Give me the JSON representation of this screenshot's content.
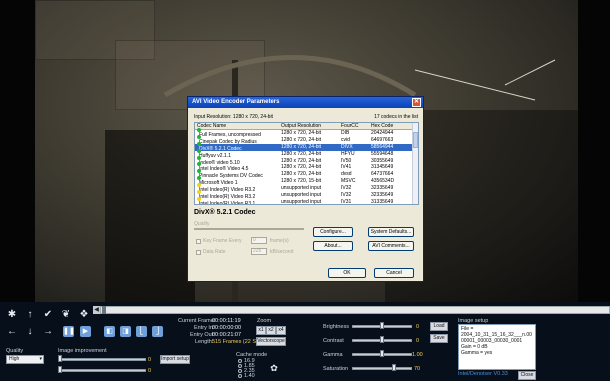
{
  "dialog": {
    "title": "AVI Video Encoder Parameters",
    "input_resolution": "Input Resolution:  1280 x 720, 24-bit",
    "codec_count": "17 codecs in the list",
    "columns": [
      "Codec Name",
      "Output Resolution",
      "FourCC",
      "Hex Code"
    ],
    "codecs": [
      {
        "name": "Full Frames, uncompressed",
        "res": "1280 x 720, 24-bit",
        "fourcc": "DIB",
        "hex": "20424944",
        "status": "ok"
      },
      {
        "name": "Cinepak Codec by Radius",
        "res": "1280 x 720, 24-bit",
        "fourcc": "cvid",
        "hex": "64697663",
        "status": "ok"
      },
      {
        "name": "DivX® 5.2.1 Codec",
        "res": "1280 x 720, 24-bit",
        "fourcc": "DIVX",
        "hex": "58564944",
        "status": "ok",
        "selected": true
      },
      {
        "name": "Huffyuv v2.1.1",
        "res": "1280 x 720, 24-bit",
        "fourcc": "HFYU",
        "hex": "55594648",
        "status": "ok"
      },
      {
        "name": "Indeo® video 5.10",
        "res": "1280 x 720, 24-bit",
        "fourcc": "IV50",
        "hex": "30355649",
        "status": "ok"
      },
      {
        "name": "Intel Indeo® Video 4.5",
        "res": "1280 x 720, 24-bit",
        "fourcc": "IV41",
        "hex": "31345649",
        "status": "ok"
      },
      {
        "name": "Pinnacle Systems DV Codec",
        "res": "1280 x 720, 24-bit",
        "fourcc": "dvsd",
        "hex": "64737664",
        "status": "ok"
      },
      {
        "name": "Microsoft Video 1",
        "res": "1280 x 720, 15-bit",
        "fourcc": "MSVC",
        "hex": "4356534D",
        "status": "ok"
      },
      {
        "name": "Intel Indeo(R) Video R3.2",
        "res": "unsupported input",
        "fourcc": "IV32",
        "hex": "32335649",
        "status": "warn"
      },
      {
        "name": "Intel Indeo(R) Video R3.2",
        "res": "unsupported input",
        "fourcc": "IV32",
        "hex": "32335649",
        "status": "warn"
      },
      {
        "name": "Intel Indeo(R) Video R3.1",
        "res": "unsupported input",
        "fourcc": "IV31",
        "hex": "31335649",
        "status": "warn"
      }
    ],
    "selected_codec": "DivX® 5.2.1 Codec",
    "quality_label": "Quality",
    "key_frame_label": "Key Frame Every",
    "key_frame_value": "0",
    "key_frame_unit": "frame(s)",
    "data_rate_label": "Data Rate",
    "data_rate_value": "225",
    "data_rate_unit": "kB/second",
    "buttons": {
      "configure": "Configure...",
      "system_defaults": "System Defaults...",
      "about": "About...",
      "avi_comments": "AVI Comments...",
      "ok": "OK",
      "cancel": "Cancel"
    },
    "close_glyph": "✕"
  },
  "controls": {
    "current_frame_label": "Current Frame:",
    "current_frame": "00:00:11:19",
    "entry_in_label": "Entry In:",
    "entry_in": "00:00:00:00",
    "entry_out_label": "Entry Out:",
    "entry_out": "00:00:21:07",
    "length_label": "Length:",
    "length": "515 Frames (22 Sec)",
    "zoom_label": "Zoom",
    "zoom_buttons": [
      "x1",
      "x2",
      "x4"
    ],
    "vectorscope": "Vectorscope",
    "quality_label": "Quality",
    "quality_value": "High",
    "image_improvement_label": "Image improvement",
    "import_setup": "Import setup",
    "cache_label": "Cache mode",
    "cache_options": [
      "16.9",
      "1.85",
      "2.35",
      "1.40"
    ],
    "image_setup_label": "Image setup",
    "load": "Load",
    "save": "Save",
    "close": "Close",
    "setup_text": [
      "File =",
      "2004_10_31_15_16_32___n.00",
      "00001_00003_00030_0001",
      "Gain = 0 dB",
      "Gamma = yes"
    ],
    "footer_text": "Intel/Denoiser V0.33",
    "improvement_values": [
      "0",
      "0"
    ],
    "adjustments": [
      {
        "label": "Brightness",
        "value": "0"
      },
      {
        "label": "Contrast",
        "value": "0"
      },
      {
        "label": "Gamma",
        "value": "1.00"
      },
      {
        "label": "Saturation",
        "value": "70"
      }
    ],
    "accent": "#f0c95a"
  }
}
